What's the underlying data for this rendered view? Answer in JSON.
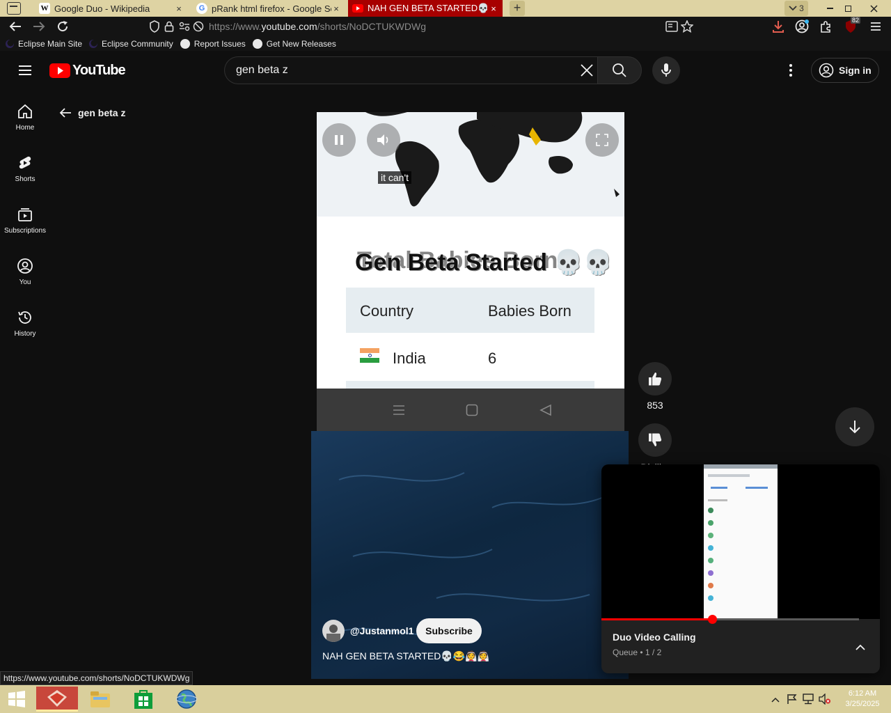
{
  "browser": {
    "tabs": [
      {
        "title": "Google Duo - Wikipedia",
        "icon": "wikipedia-icon",
        "close": "×"
      },
      {
        "title": "pRank html firefox - Google Sea",
        "icon": "google-icon",
        "close": "×"
      },
      {
        "title": "NAH GEN BETA STARTED💀😂👰",
        "icon": "youtube-icon",
        "close": "×",
        "active": true
      }
    ],
    "new_tab": "+",
    "tab_count": "3",
    "url_prefix": "https://www.",
    "url_domain": "youtube.com",
    "url_path": "/shorts/NoDCTUKWDWg",
    "addon_badge": "82",
    "bookmarks": [
      "Eclipse Main Site",
      "Eclipse Community",
      "Report Issues",
      "Get New Releases"
    ]
  },
  "youtube": {
    "logo_text": "YouTube",
    "search_value": "gen beta z",
    "signin_label": "Sign in",
    "back_query": "gen beta z",
    "guide": [
      "Home",
      "Shorts",
      "Subscriptions",
      "You",
      "History"
    ]
  },
  "short": {
    "caption": "it can't",
    "overlay_title": "Gen Beta Started 💀💀",
    "ghost_title": "Total Babies Born 0",
    "table_headers": [
      "Country",
      "Babies Born"
    ],
    "rows": [
      {
        "country": "India",
        "value": "6"
      }
    ],
    "channel": "@Justanmol1",
    "subscribe_label": "Subscribe",
    "title": "NAH GEN BETA STARTED💀😂👰👰",
    "likes": "853",
    "dislike_label": "Dislike"
  },
  "miniplayer": {
    "title": "Duo Video Calling",
    "queue": "Queue • 1 / 2",
    "progress": 0.43
  },
  "status_url": "https://www.youtube.com/shorts/NoDCTUKWDWg",
  "taskbar": {
    "time": "6:12 AM",
    "date": "3/25/2025"
  },
  "colors": {
    "accent": "#ff0000",
    "tab_active": "#a70000",
    "taskbar": "#d9cf9c",
    "tab_strip": "#ded3a3",
    "india_saffron": "#f4a261",
    "india_green": "#2a9d3f"
  }
}
